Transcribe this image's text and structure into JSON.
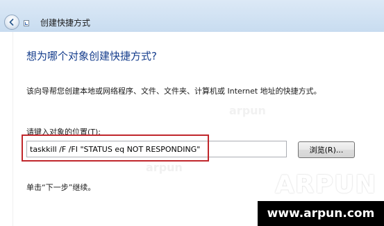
{
  "window": {
    "title": "创建快捷方式",
    "back_icon": "back-arrow-icon",
    "app_icon": "shortcut-icon"
  },
  "page": {
    "heading": "想为哪个对象创建快捷方式?",
    "description": "该向导帮您创建本地或网络程序、文件、文件夹、计算机或 Internet 地址的快捷方式。",
    "location_label": "请键入对象的位置(T):",
    "location_value": "taskkill /F /FI \"STATUS eq NOT RESPONDING\"",
    "browse_label": "浏览(R)...",
    "hint": "单击“下一步”继续。"
  },
  "colors": {
    "heading": "#153d8c",
    "highlight": "#c0262b",
    "titlebar": "#c8dcf0"
  },
  "watermark": {
    "logo": "ARPUN",
    "url": "www.arpun.com"
  }
}
